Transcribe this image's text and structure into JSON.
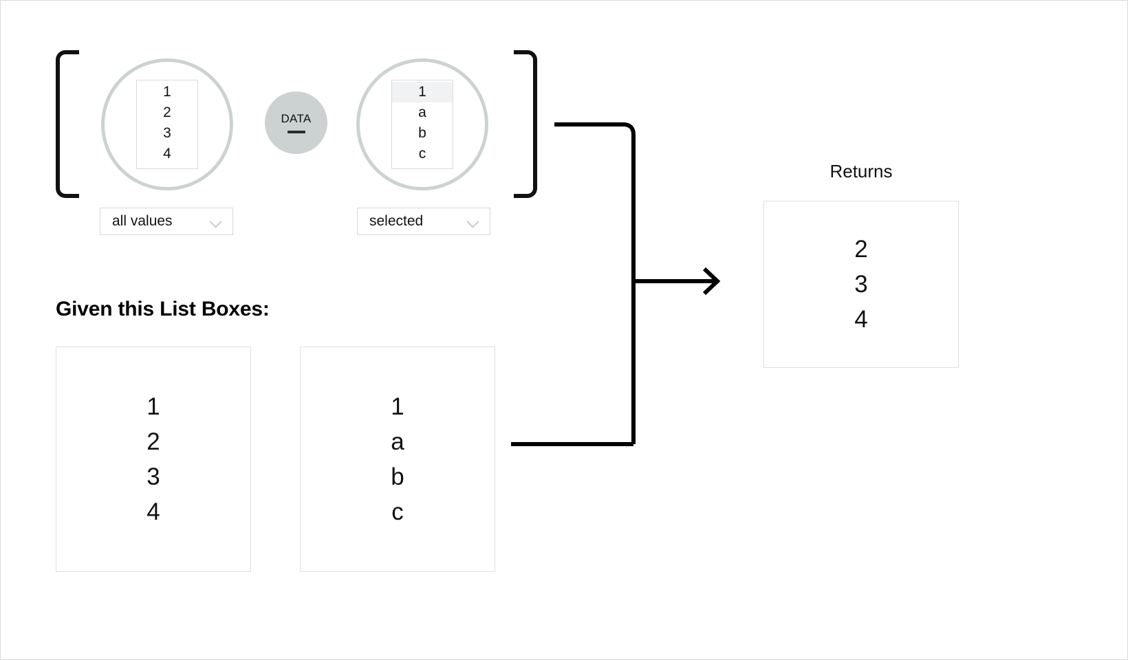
{
  "diagram": {
    "title_heading": "Given this List Boxes:",
    "formula": {
      "bracket_open": "[",
      "bracket_close": "]",
      "operator_badge": {
        "label": "DATA",
        "symbol": "minus-dash",
        "color": "#ccd1d1"
      },
      "left_operand": {
        "circle_color": "#ccd2d2",
        "listbox_items": [
          "1",
          "2",
          "3",
          "4"
        ],
        "selected_indices": [],
        "select_value": "all values",
        "select_icon": "chevron-down-icon"
      },
      "right_operand": {
        "circle_color": "#ccd2d2",
        "listbox_items": [
          "1",
          "a",
          "b",
          "c"
        ],
        "selected_indices": [
          0
        ],
        "select_value": "selected",
        "select_icon": "chevron-down-icon"
      }
    },
    "given_listboxes": [
      {
        "items": [
          "1",
          "2",
          "3",
          "4"
        ]
      },
      {
        "items": [
          "1",
          "a",
          "b",
          "c"
        ]
      }
    ],
    "returns": {
      "label": "Returns",
      "items": [
        "2",
        "3",
        "4"
      ]
    },
    "connector": {
      "arrow_icon": "arrow-right-icon",
      "stroke_color": "#000000"
    }
  }
}
